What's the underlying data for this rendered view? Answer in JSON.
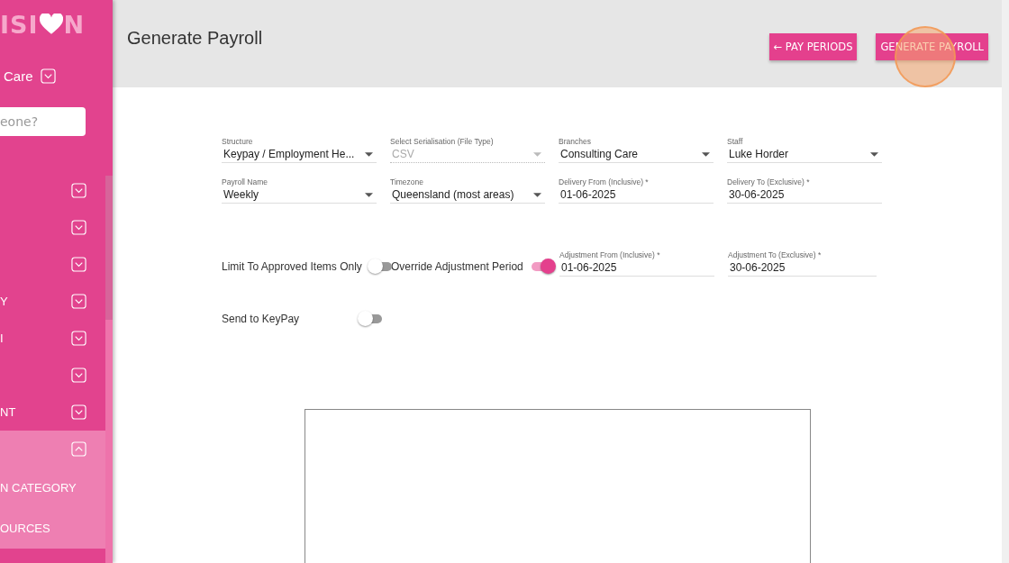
{
  "sidebar": {
    "logo": {
      "left": "ISI",
      "right": "N"
    },
    "org": "Care",
    "search": {
      "placeholder": "eone?"
    },
    "items": [
      {
        "expanded": false
      },
      {
        "expanded": false
      },
      {
        "expanded": false
      },
      {
        "label": "Y",
        "expanded": false
      },
      {
        "label": "I",
        "expanded": false
      },
      {
        "expanded": false
      },
      {
        "label": "NT",
        "expanded": false
      },
      {
        "expanded": true,
        "children": [
          {
            "label": "N CATEGORY"
          },
          {
            "label": "OURCES"
          }
        ]
      }
    ]
  },
  "header": {
    "title": "Generate Payroll",
    "buttons": [
      {
        "label": "← PAY PERIODS"
      },
      {
        "label": "GENERATE PAYROLL"
      }
    ]
  },
  "fields": [
    {
      "kind": "select",
      "label": "Structure",
      "value": "Keypay / Employment He...",
      "disabled": false
    },
    {
      "kind": "select",
      "label": "Select Serialisation (File Type)",
      "value": "CSV",
      "disabled": true
    },
    {
      "kind": "select",
      "label": "Branches",
      "value": "Consulting Care",
      "disabled": false
    },
    {
      "kind": "select",
      "label": "Staff",
      "value": "Luke Horder",
      "disabled": false
    },
    {
      "kind": "select",
      "label": "Payroll Name",
      "value": "Weekly",
      "disabled": false
    },
    {
      "kind": "select",
      "label": "Timezone",
      "value": "Queensland (most areas)",
      "disabled": false
    },
    {
      "kind": "text",
      "label": "Delivery From (Inclusive) *",
      "value": "01-06-2025",
      "disabled": false
    },
    {
      "kind": "text",
      "label": "Delivery To (Exclusive) *",
      "value": "30-06-2025",
      "disabled": false
    }
  ],
  "toggles_row": [
    {
      "kind": "toggle",
      "label": "Limit To Approved Items Only",
      "on": false
    },
    {
      "kind": "toggle",
      "label": "Override Adjustment Period",
      "on": true
    },
    {
      "kind": "text",
      "label": "Adjustment From (Inclusive) *",
      "value": "01-06-2025",
      "disabled": false
    },
    {
      "kind": "text",
      "label": "Adjustment To (Exclusive) *",
      "value": "30-06-2025",
      "disabled": false
    }
  ],
  "send_toggle": {
    "label": "Send to KeyPay",
    "on": false
  }
}
